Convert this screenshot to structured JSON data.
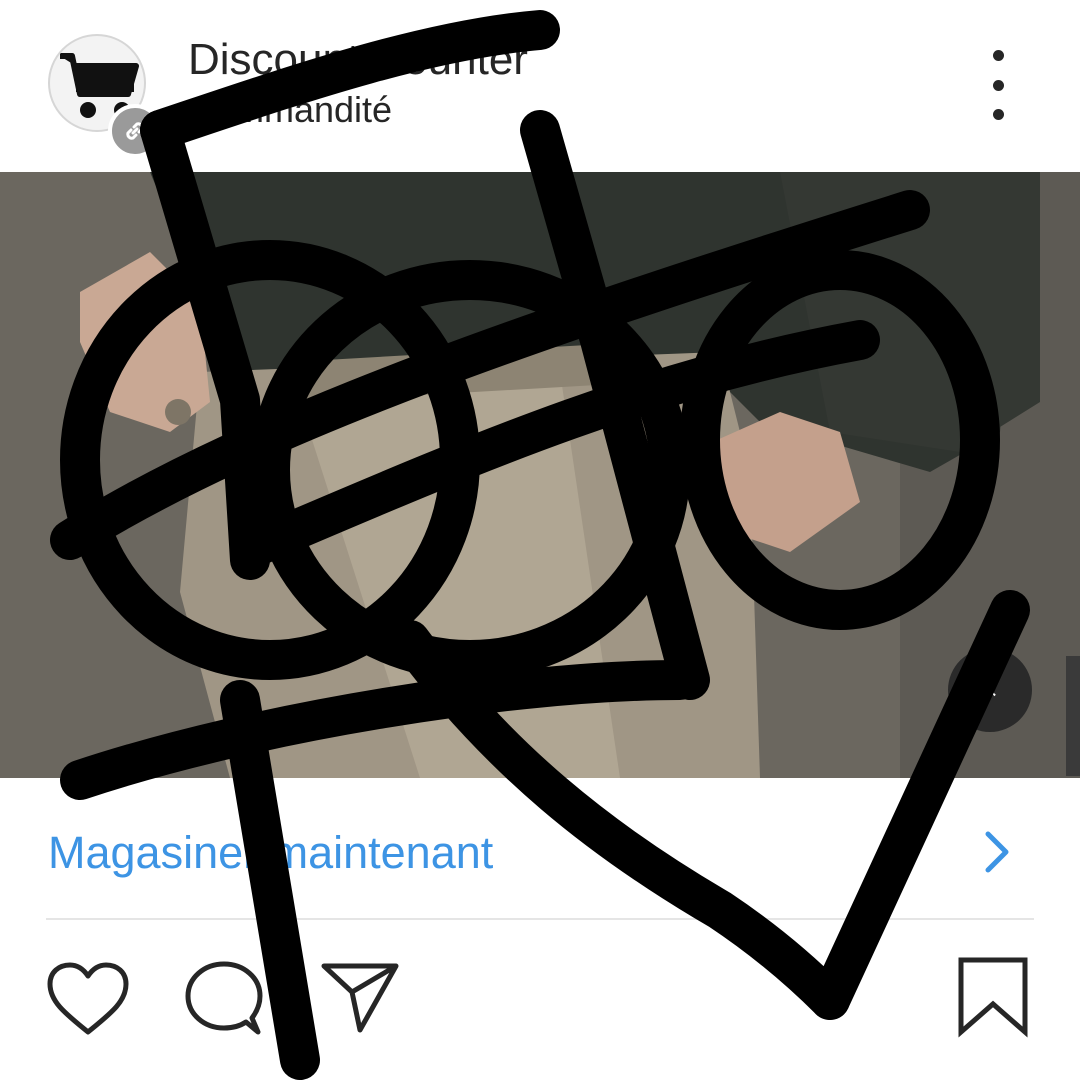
{
  "post": {
    "account_name": "Discount Counter",
    "sponsored_label": "Commandité",
    "avatar_icon": "shopping-cart-icon",
    "badge_icon": "link-icon",
    "more_icon": "more-vertical-icon"
  },
  "media": {
    "mute_icon": "muted-speaker-icon",
    "mute_glyph": "×"
  },
  "cta": {
    "label": "Magasiner maintenant",
    "chevron_icon": "chevron-right-icon",
    "color": "#3d94e4"
  },
  "actions": {
    "like_icon": "heart-icon",
    "comment_icon": "comment-icon",
    "share_icon": "paper-plane-icon",
    "save_icon": "bookmark-icon"
  }
}
